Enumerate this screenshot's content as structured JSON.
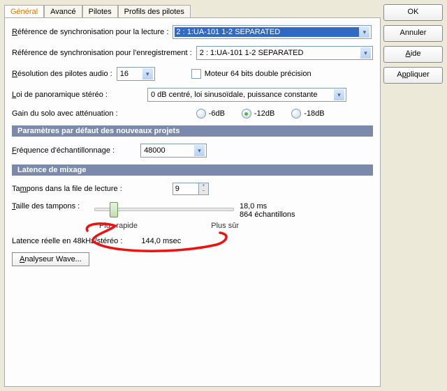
{
  "side": {
    "ok": "OK",
    "cancel": "Annuler",
    "help": "Aide",
    "apply": "Appliquer"
  },
  "tabs": {
    "general": "Général",
    "advanced": "Avancé",
    "drivers": "Pilotes",
    "profiles": "Profils des pilotes"
  },
  "playback_ref_label": "Référence de synchronisation pour la lecture :",
  "playback_ref_value": "2 : 1:UA-101 1-2 SEPARATED",
  "record_ref_label": "Référence de synchronisation pour l'enregistrement :",
  "record_ref_value": "2 : 1:UA-101 1-2 SEPARATED",
  "driver_res_label": "Résolution des pilotes audio :",
  "driver_res_value": "16",
  "engine64_label": "Moteur 64 bits double précision",
  "panlaw_label": "Loi de panoramique stéréo :",
  "panlaw_value": "0 dB centré, loi sinusoïdale, puissance constante",
  "solo_label": "Gain du solo avec atténuation :",
  "radios": {
    "r1": "-6dB",
    "r2": "-12dB",
    "r3": "-18dB"
  },
  "section_projects": "Paramètres par défaut des nouveaux projets",
  "samplerate_label": "Fréquence d'échantillonnage :",
  "samplerate_value": "48000",
  "section_latency": "Latence de mixage",
  "buffers_label": "Tampons dans la file de lecture :",
  "buffers_value": "9",
  "bufsize_label": "Taille des tampons :",
  "slider": {
    "fast": "Plus rapide",
    "safe": "Plus sûr"
  },
  "latency_ms": "18,0 ms",
  "latency_samples": "864 échantillons",
  "real_latency_label": "Latence réelle en 48kHz/stéréo :",
  "real_latency_value": "144,0 msec",
  "wave_analyzer": "Analyseur Wave..."
}
